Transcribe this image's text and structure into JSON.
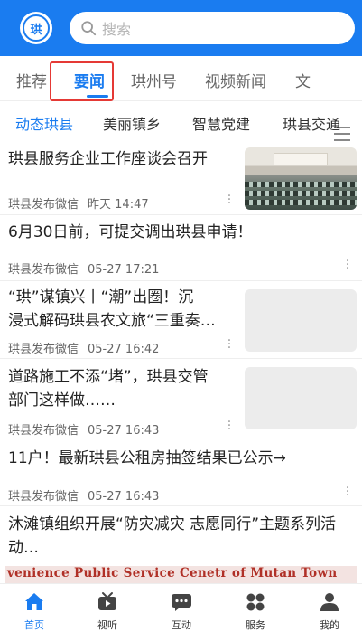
{
  "search": {
    "placeholder": "搜索"
  },
  "logo_text": "珙",
  "tabs": [
    {
      "label": "推荐"
    },
    {
      "label": "要闻"
    },
    {
      "label": "珙州号"
    },
    {
      "label": "视频新闻"
    },
    {
      "label": "文"
    }
  ],
  "subtabs": [
    {
      "label": "动态珙县"
    },
    {
      "label": "美丽镇乡"
    },
    {
      "label": "智慧党建"
    },
    {
      "label": "珙县交通"
    }
  ],
  "news": [
    {
      "title": "珙县服务企业工作座谈会召开",
      "source": "珙县发布微信",
      "time": "昨天 14:47"
    },
    {
      "title": "6月30日前，可提交调出珙县申请！",
      "source": "珙县发布微信",
      "time": "05-27 17:21"
    },
    {
      "title_line1": "“珙”谋镇兴丨“潮”出圈！沉",
      "title_line2": "浸式解码珙县农文旅“三重奏…",
      "source": "珙县发布微信",
      "time": "05-27 16:42"
    },
    {
      "title_line1": "道路施工不添“堵”，珙县交管",
      "title_line2": "部门这样做……",
      "source": "珙县发布微信",
      "time": "05-27 16:43"
    },
    {
      "title": "11户！最新珙县公租房抽签结果已公示→",
      "source": "珙县发布微信",
      "time": "05-27 16:43"
    },
    {
      "title_line1": "沐滩镇组织开展“防灾减灾 志愿同行”主题系列活",
      "title_line2": "动…"
    }
  ],
  "banner_text": "venience Public Service Cenetr of Mutan Town",
  "bottom_nav": [
    {
      "label": "首页",
      "icon": "home-icon"
    },
    {
      "label": "视听",
      "icon": "tv-icon"
    },
    {
      "label": "互动",
      "icon": "chat-icon"
    },
    {
      "label": "服务",
      "icon": "grid-icon"
    },
    {
      "label": "我的",
      "icon": "user-icon"
    }
  ],
  "colors": {
    "accent": "#1a7cf0",
    "highlight_box": "#e53935"
  }
}
